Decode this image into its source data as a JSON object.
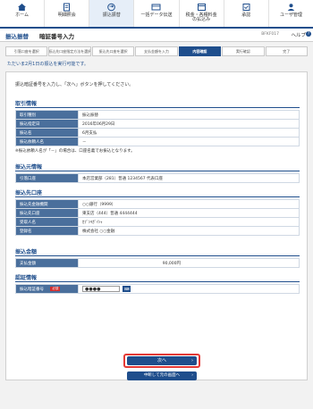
{
  "nav": [
    {
      "label": "ホーム",
      "icon": "home-icon"
    },
    {
      "label": "明細照会",
      "icon": "document-icon"
    },
    {
      "label": "振込振替",
      "icon": "transfer-icon"
    },
    {
      "label": "一括データ伝送",
      "icon": "data-icon"
    },
    {
      "label": "税金・各種料金\nの払込み",
      "icon": "tax-icon"
    },
    {
      "label": "承認",
      "icon": "approval-icon"
    },
    {
      "label": "ユーザ管理",
      "icon": "user-icon"
    }
  ],
  "header": {
    "category": "振込振替",
    "title": "暗証番号入力",
    "screen_id": "BFKF017",
    "help": "ヘルプ"
  },
  "steps": [
    "引落口座を選択",
    "振込先口座指定方法を選択",
    "振込先口座を選択",
    "支払金額を入力",
    "内容確認",
    "実行確認",
    "完了"
  ],
  "current_step": 4,
  "notice": "ただいま2月1日の振込を実行可能です。",
  "instruction": "振込暗証番号を入力し、「次へ」ボタンを押してください。",
  "sections": {
    "transaction": {
      "title": "取引情報",
      "rows": [
        {
          "label": "取引種別",
          "value": "振込振替"
        },
        {
          "label": "振込指定日",
          "value": "2016年06月29日"
        },
        {
          "label": "振込名",
          "value": "6月支払"
        },
        {
          "label": "振込依頼人名",
          "value": "－"
        }
      ],
      "note": "※振込依頼人名が「－」の場合は、口座名義でお振込となります。"
    },
    "source": {
      "title": "振込元情報",
      "rows": [
        {
          "label": "引落口座",
          "value": "本店営業部（281）普通 1234567 代表口座"
        }
      ]
    },
    "destination": {
      "title": "振込先口座",
      "rows": [
        {
          "label": "振込先金融機関",
          "value": "○○銀行（9999）"
        },
        {
          "label": "振込先口座",
          "value": "東支店（444）普通 4444444"
        },
        {
          "label": "受取人名",
          "value": "ｶﾌﾞｼｷｶﾞｲｼｬ"
        },
        {
          "label": "登録名",
          "value": "株式会社 ○○金融"
        }
      ]
    },
    "amount": {
      "title": "振込金額",
      "rows": [
        {
          "label": "支払金額",
          "value": "90,000円"
        }
      ]
    },
    "auth": {
      "title": "認証情報",
      "rows": [
        {
          "label": "振込暗証番号",
          "required": "必須",
          "value": "●●●●"
        }
      ]
    }
  },
  "buttons": {
    "next": "次へ",
    "back": "中断して元の画面へ"
  },
  "colors": {
    "primary": "#1f4e8c",
    "label_bg": "#4a6f9c",
    "highlight": "#e53935",
    "required": "#d32f2f"
  }
}
